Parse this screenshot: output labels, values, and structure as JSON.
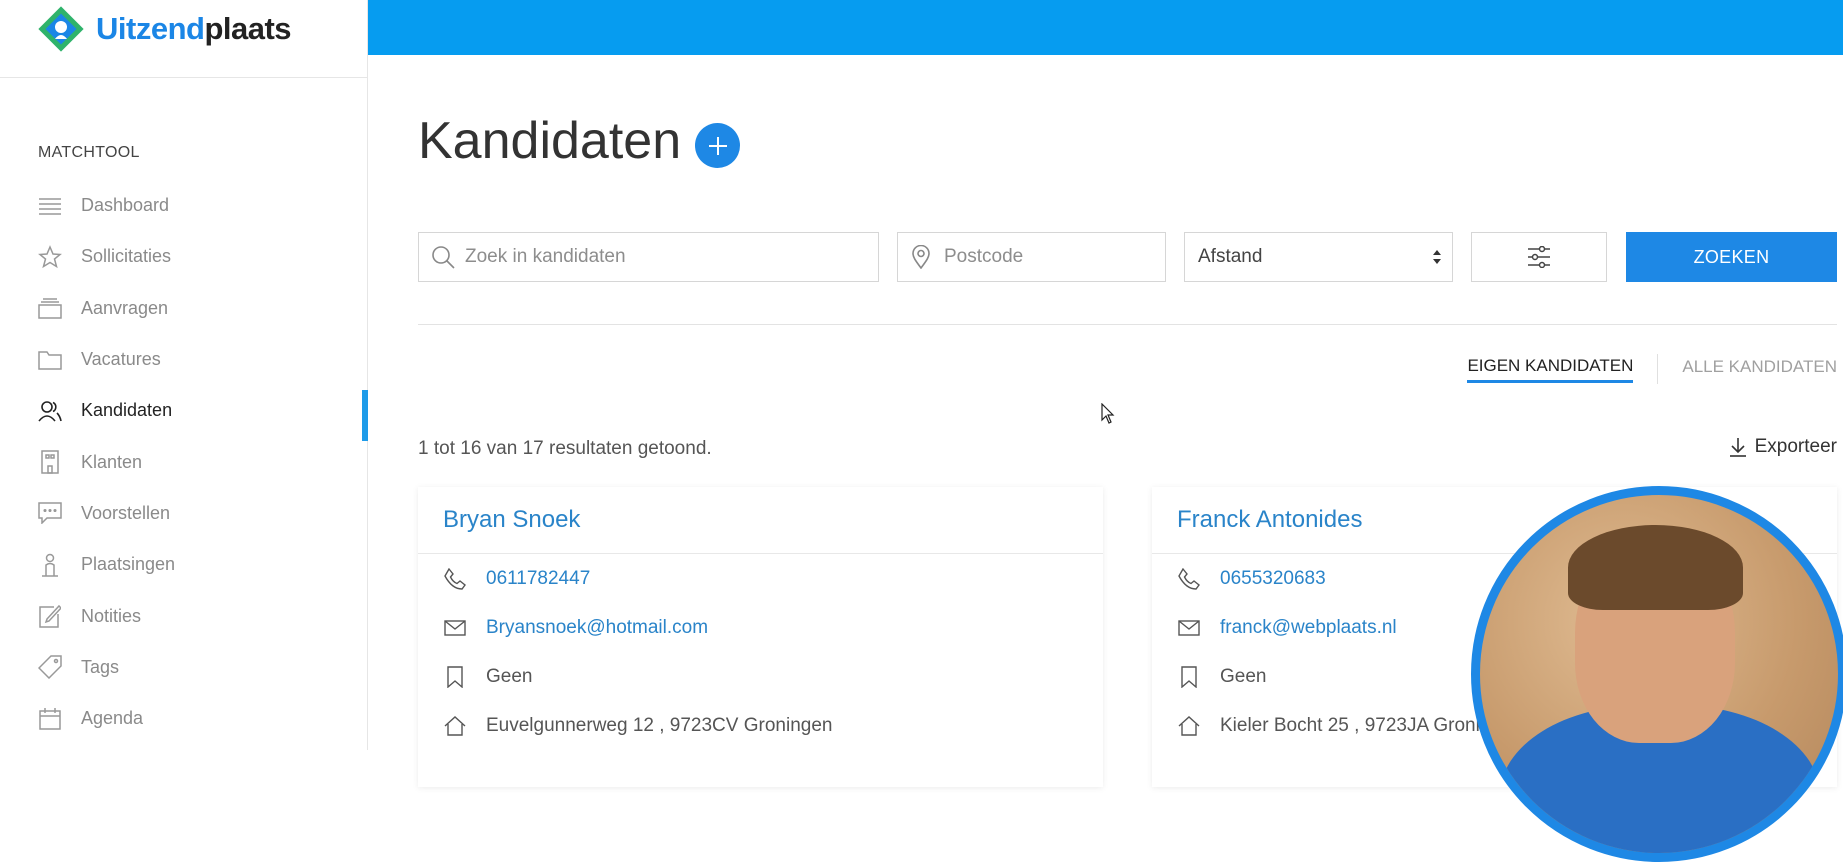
{
  "app": {
    "logo_blue": "Uitzend",
    "logo_dark": "plaats"
  },
  "sidebar": {
    "section_label": "MATCHTOOL",
    "items": [
      {
        "label": "Dashboard",
        "icon": "menu-lines-icon",
        "active": false
      },
      {
        "label": "Sollicitaties",
        "icon": "star-icon",
        "active": false
      },
      {
        "label": "Aanvragen",
        "icon": "stack-icon",
        "active": false
      },
      {
        "label": "Vacatures",
        "icon": "folder-icon",
        "active": false
      },
      {
        "label": "Kandidaten",
        "icon": "users-icon",
        "active": true
      },
      {
        "label": "Klanten",
        "icon": "building-icon",
        "active": false
      },
      {
        "label": "Voorstellen",
        "icon": "chat-icon",
        "active": false
      },
      {
        "label": "Plaatsingen",
        "icon": "person-icon",
        "active": false
      },
      {
        "label": "Notities",
        "icon": "edit-icon",
        "active": false
      },
      {
        "label": "Tags",
        "icon": "tag-icon",
        "active": false
      },
      {
        "label": "Agenda",
        "icon": "calendar-icon",
        "active": false
      }
    ]
  },
  "main": {
    "title": "Kandidaten",
    "search": {
      "placeholder": "Zoek in kandidaten",
      "postcode_placeholder": "Postcode",
      "distance_selected": "Afstand",
      "submit_label": "ZOEKEN"
    },
    "tabs": [
      {
        "label": "EIGEN KANDIDATEN",
        "active": true
      },
      {
        "label": "ALLE KANDIDATEN",
        "active": false
      }
    ],
    "results_text": "1 tot 16 van 17 resultaten getoond.",
    "export_label": "Exporteer",
    "candidates": [
      {
        "name": "Bryan Snoek",
        "phone": "0611782447",
        "email": "Bryansnoek@hotmail.com",
        "tag": "Geen",
        "address": "Euvelgunnerweg 12 , 9723CV Groningen"
      },
      {
        "name": "Franck Antonides",
        "phone": "0655320683",
        "email": "franck@webplaats.nl",
        "tag": "Geen",
        "address": "Kieler Bocht 25 , 9723JA Groni"
      }
    ]
  },
  "colors": {
    "accent": "#1e88e5",
    "topbar": "#069cf0",
    "link": "#2a84c9"
  }
}
